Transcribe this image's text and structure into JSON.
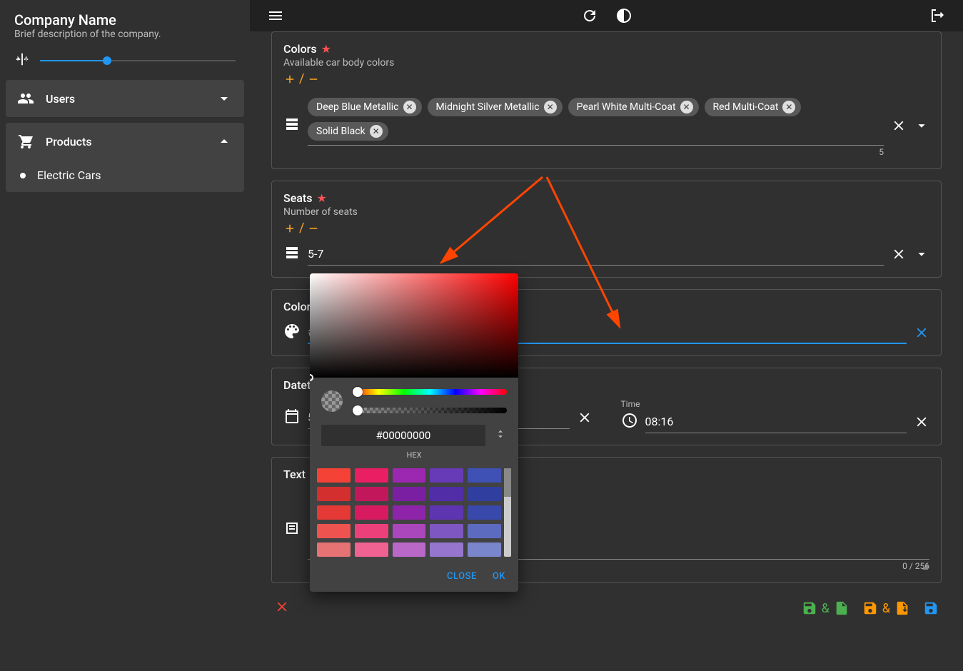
{
  "sidebar": {
    "title": "Company Name",
    "desc": "Brief description of the company.",
    "users_label": "Users",
    "products_label": "Products",
    "sub_item": "Electric Cars"
  },
  "panels": {
    "colors": {
      "label": "Colors",
      "desc": "Available car body colors",
      "chips": [
        "Deep Blue Metallic",
        "Midnight Silver Metallic",
        "Pearl White Multi-Coat",
        "Red Multi-Coat",
        "Solid Black"
      ],
      "count": "5"
    },
    "seats": {
      "label": "Seats",
      "desc": "Number of seats",
      "value": "5-7"
    },
    "color": {
      "label": "Color",
      "value": "#"
    },
    "datetime": {
      "label": "Datet",
      "date_value": "5",
      "time_label": "Time",
      "time_value": "08:16"
    },
    "text": {
      "label": "Text",
      "counter": "0 / 256"
    }
  },
  "picker": {
    "hex_value": "#00000000",
    "hex_label": "HEX",
    "close": "CLOSE",
    "ok": "OK",
    "swatches": [
      "#f44336",
      "#e91e63",
      "#9c27b0",
      "#673ab7",
      "#3f51b5",
      "#d32f2f",
      "#c2185b",
      "#7b1fa2",
      "#512da8",
      "#303f9f",
      "#e53935",
      "#d81b60",
      "#8e24aa",
      "#5e35b1",
      "#3949ab",
      "#ef5350",
      "#ec407a",
      "#ab47bc",
      "#7e57c2",
      "#5c6bc0",
      "#e57373",
      "#f06292",
      "#ba68c8",
      "#9575cd",
      "#7986cb"
    ]
  },
  "amp": "&"
}
